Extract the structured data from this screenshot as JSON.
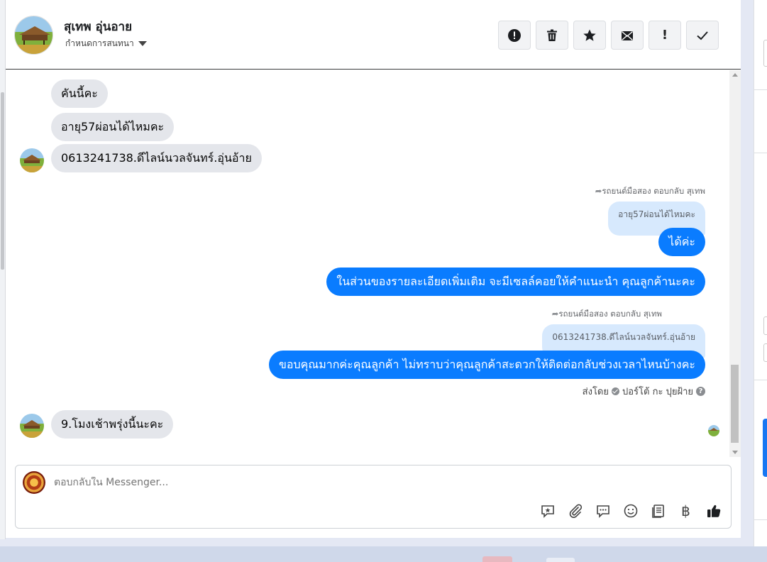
{
  "header": {
    "contact_name": "สุเทพ อุ่นอาย",
    "assign_label": "กำหนดการสนทนา"
  },
  "actions": [
    {
      "name": "report-spam-button",
      "icon": "alert-circle-icon"
    },
    {
      "name": "delete-button",
      "icon": "trash-icon"
    },
    {
      "name": "star-button",
      "icon": "star-icon"
    },
    {
      "name": "mark-unread-button",
      "icon": "envelope-icon"
    },
    {
      "name": "follow-up-button",
      "icon": "exclamation-icon",
      "glyph": "!"
    },
    {
      "name": "mark-done-button",
      "icon": "check-icon"
    }
  ],
  "messages": {
    "in1": "คันนี้คะ",
    "in2": "อายุ57ผ่อนได้ไหมคะ",
    "in3": "0613241738.ดีไลน์นวลจันทร์.อุ่นอ้าย",
    "reply1_header": "รถยนต์มือสอง ตอบกลับ สุเทพ",
    "reply1_quote": "อายุ57ผ่อนได้ไหมคะ",
    "out1": "ได้ค่ะ",
    "out2": "ในส่วนของรายละเอียดเพิ่มเติม จะมีเซลล์คอยให้คำแนะนำ คุณลูกค้านะคะ",
    "reply2_header": "รถยนต์มือสอง ตอบกลับ สุเทพ",
    "reply2_quote": "0613241738.ดีไลน์นวลจันทร์.อุ่นอ้าย",
    "out3": "ขอบคุณมากค่ะคุณลูกค้า ไม่ทราบว่าคุณลูกค้าสะดวกให้ติดต่อกลับช่วงเวลาไหนบ้างคะ",
    "sent_by_prefix": "ส่งโดย",
    "sent_by_name": "ปอร์โต้ กะ ปุยฝ้าย",
    "in4": "9.โมงเช้าพรุ่งนี้นะคะ"
  },
  "composer": {
    "placeholder": "ตอบกลับใน Messenger..."
  },
  "tools": [
    {
      "name": "saved-reply-icon"
    },
    {
      "name": "attachment-icon"
    },
    {
      "name": "chat-bubble-icon"
    },
    {
      "name": "emoji-icon"
    },
    {
      "name": "notes-icon"
    },
    {
      "name": "payment-icon",
      "glyph": "฿"
    },
    {
      "name": "thumbs-up-icon"
    }
  ],
  "colors": {
    "outgoing_bubble": "#0a7cff",
    "incoming_bubble": "#e4e6eb",
    "quote_bubble": "#d7e9fd",
    "action_bg": "#f2f3f5"
  }
}
